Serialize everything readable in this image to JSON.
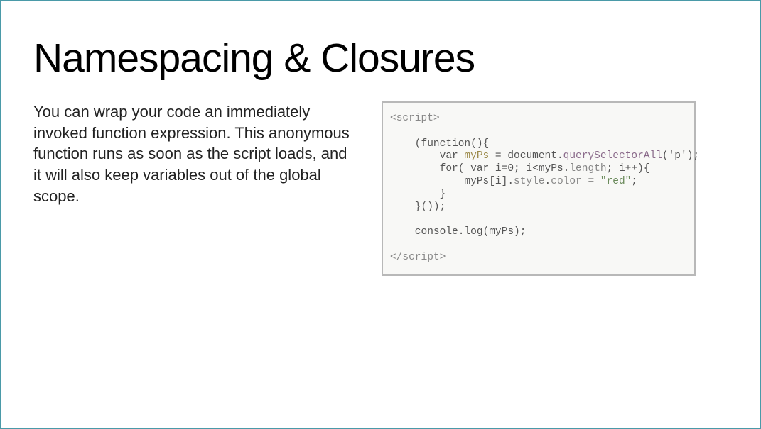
{
  "slide": {
    "title": "Namespacing & Closures",
    "body": "You can wrap your code an immediately invoked function expression. This anonymous function runs as soon as the script loads, and it will also keep variables out of the global scope.",
    "code": {
      "line1": "<script>",
      "line2": "    (function(){",
      "line3_a": "        var ",
      "line3_b": "myPs",
      "line3_c": " = document.",
      "line3_d": "querySelectorAll",
      "line3_e": "('p');",
      "line4": "        for( var i=0; i<myPs.",
      "line4_b": "length",
      "line4_c": "; i++){",
      "line5_a": "            myPs[i].",
      "line5_b": "style",
      "line5_c": ".",
      "line5_d": "color",
      "line5_e": " = ",
      "line5_f": "\"red\"",
      "line5_g": ";",
      "line6": "        }",
      "line7": "    }());",
      "line8": "",
      "line9": "    console.log(myPs);",
      "line10": "",
      "line11": "</script>"
    }
  }
}
